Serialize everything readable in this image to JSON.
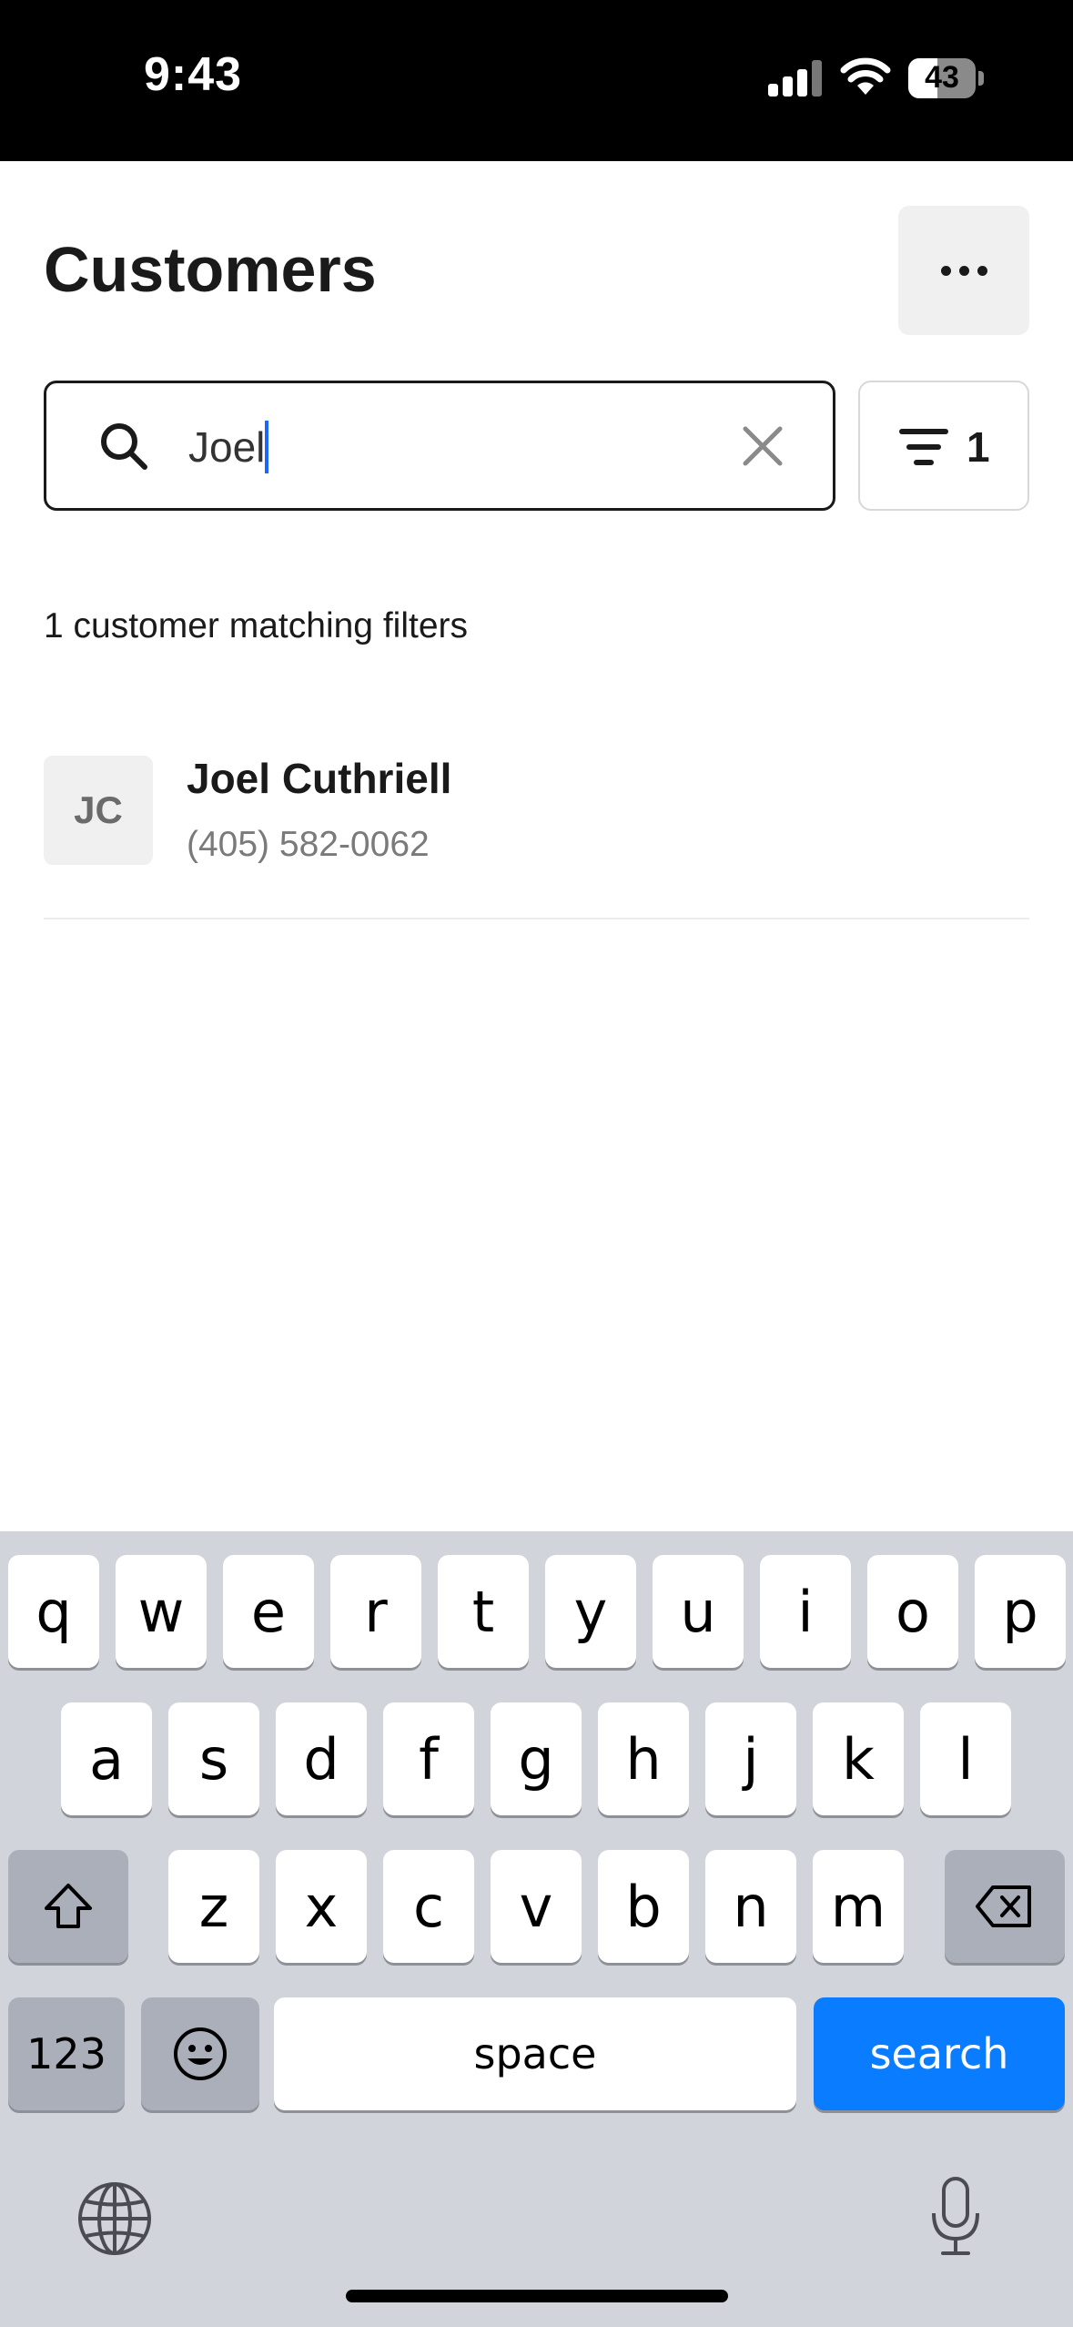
{
  "status_bar": {
    "time": "9:43",
    "battery_level": "43",
    "battery_fraction": 0.43
  },
  "header": {
    "title": "Customers"
  },
  "search": {
    "value": "Joel"
  },
  "filter": {
    "count": "1"
  },
  "results": {
    "summary": "1 customer matching filters",
    "customers": [
      {
        "initials": "JC",
        "name": "Joel Cuthriell",
        "phone": "(405) 582-0062"
      }
    ]
  },
  "keyboard": {
    "row1": [
      "q",
      "w",
      "e",
      "r",
      "t",
      "y",
      "u",
      "i",
      "o",
      "p"
    ],
    "row2": [
      "a",
      "s",
      "d",
      "f",
      "g",
      "h",
      "j",
      "k",
      "l"
    ],
    "row3": [
      "z",
      "x",
      "c",
      "v",
      "b",
      "n",
      "m"
    ],
    "numbers_label": "123",
    "space_label": "space",
    "search_label": "search"
  },
  "colors": {
    "accent": "#0a7cff",
    "caret": "#1a66ff",
    "keyboard_bg": "#d1d4db"
  }
}
